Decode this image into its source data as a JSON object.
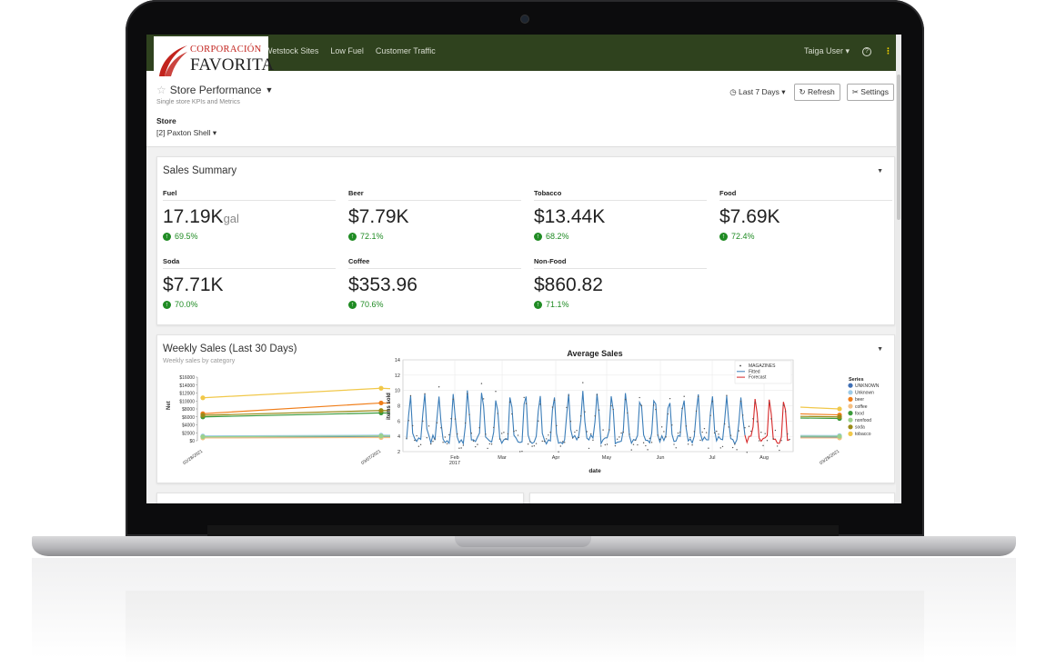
{
  "brand": {
    "line1": "CORPORACIÓN",
    "line2": "FAVORITA"
  },
  "nav": {
    "links": [
      "Wetstock Sites",
      "Low Fuel",
      "Customer Traffic"
    ],
    "user": "Taiga User",
    "help_icon": "question-circle-icon",
    "menu_icon": "kebab-icon"
  },
  "page": {
    "title": "Store Performance",
    "subtitle": "Single store KPIs and Metrics",
    "store_label": "Store",
    "store_value": "[2] Paxton Shell",
    "range": "Last 7 Days",
    "refresh": "Refresh",
    "settings": "Settings"
  },
  "sales_summary": {
    "title": "Sales Summary",
    "kpis": [
      {
        "label": "Fuel",
        "value": "17.19K",
        "unit": "gal",
        "change": "69.5%"
      },
      {
        "label": "Beer",
        "value": "$7.79K",
        "unit": "",
        "change": "72.1%"
      },
      {
        "label": "Tobacco",
        "value": "$13.44K",
        "unit": "",
        "change": "68.2%"
      },
      {
        "label": "Food",
        "value": "$7.69K",
        "unit": "",
        "change": "72.4%"
      },
      {
        "label": "Soda",
        "value": "$7.71K",
        "unit": "",
        "change": "70.0%"
      },
      {
        "label": "Coffee",
        "value": "$353.96",
        "unit": "",
        "change": "70.6%"
      },
      {
        "label": "Non-Food",
        "value": "$860.82",
        "unit": "",
        "change": "71.1%"
      }
    ]
  },
  "weekly": {
    "title": "Weekly Sales (Last 30 Days)",
    "subtitle": "Weekly sales by category"
  },
  "colors": {
    "nav": "#2f421e",
    "positive": "#1f8b23",
    "brand_red": "#c2231d"
  },
  "chart_data": [
    {
      "type": "line",
      "ylabel": "Net",
      "yticks": [
        "$0",
        "$2000",
        "$4000",
        "$6000",
        "$8000",
        "$10000",
        "$12000",
        "$14000",
        "$16000"
      ],
      "ylim": [
        0,
        16000
      ],
      "xticks": [
        "02/28/2021",
        "03/07/2021",
        "03/28/2021"
      ],
      "x": [
        0,
        1,
        2
      ],
      "legend_title": "Series",
      "legend_position": "right",
      "series": [
        {
          "name": "UNKNOWN",
          "color": "#3f6fb5",
          "values": [
            1000,
            900,
            900
          ]
        },
        {
          "name": "Unknown",
          "color": "#9ecbe8",
          "values": [
            1200,
            1400,
            1300
          ]
        },
        {
          "name": "beer",
          "color": "#f07e1a",
          "values": [
            6800,
            9500,
            6500
          ]
        },
        {
          "name": "coffee",
          "color": "#f5c083",
          "values": [
            700,
            800,
            700
          ]
        },
        {
          "name": "food",
          "color": "#3a9a3a",
          "values": [
            6000,
            7000,
            5600
          ]
        },
        {
          "name": "nonfood",
          "color": "#9bd18b",
          "values": [
            1000,
            1200,
            1100
          ]
        },
        {
          "name": "soda",
          "color": "#9a8a17",
          "values": [
            6400,
            7600,
            6000
          ]
        },
        {
          "name": "tobacco",
          "color": "#f1c84a",
          "values": [
            10800,
            13200,
            8000
          ]
        }
      ]
    },
    {
      "type": "line",
      "title": "Average Sales",
      "xlabel": "date",
      "ylabel": "items sold",
      "ylim": [
        2,
        14
      ],
      "yticks": [
        2,
        4,
        6,
        8,
        10,
        12,
        14
      ],
      "xticks": [
        "Feb\n2017",
        "Mar",
        "Apr",
        "May",
        "Jun",
        "Jul",
        "Aug"
      ],
      "legend_position": "top-right",
      "series": [
        {
          "name": "MAGAZINES",
          "style": "points",
          "color": "#444444"
        },
        {
          "name": "Fitted",
          "color": "#3b7db8"
        },
        {
          "name": "Forecast",
          "color": "#d62728"
        }
      ]
    }
  ]
}
